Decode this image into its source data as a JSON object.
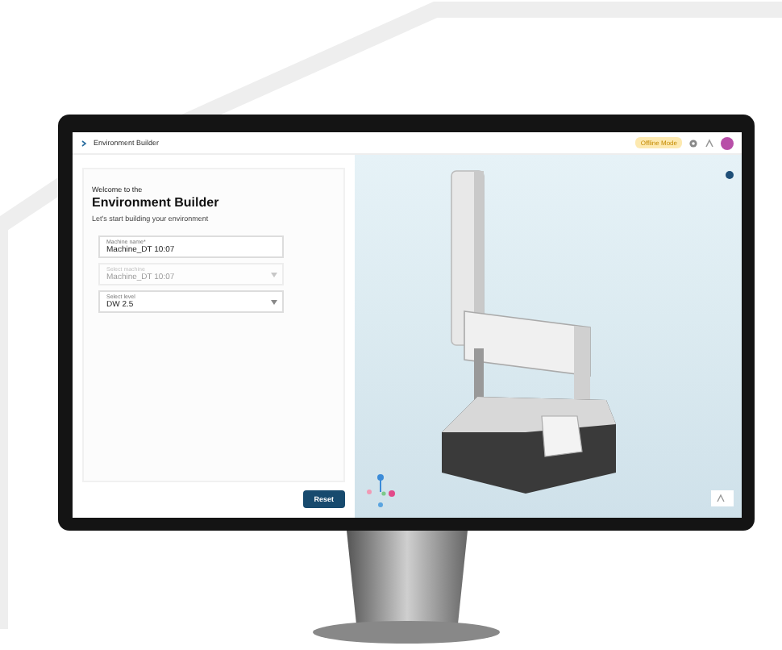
{
  "header": {
    "title": "Environment Builder",
    "badge": "Offline Mode"
  },
  "panel": {
    "greeting": "Welcome to the",
    "title": "Environment Builder",
    "subtitle": "Let's start building your environment"
  },
  "fields": [
    {
      "label": "Machine name*",
      "value": "Machine_DT 10:07",
      "kind": "text",
      "disabled": false
    },
    {
      "label": "Select machine",
      "value": "Machine_DT 10:07",
      "kind": "select",
      "disabled": true
    },
    {
      "label": "Select level",
      "value": "DW 2.5",
      "kind": "select",
      "disabled": false
    }
  ],
  "reset_button": "Reset"
}
